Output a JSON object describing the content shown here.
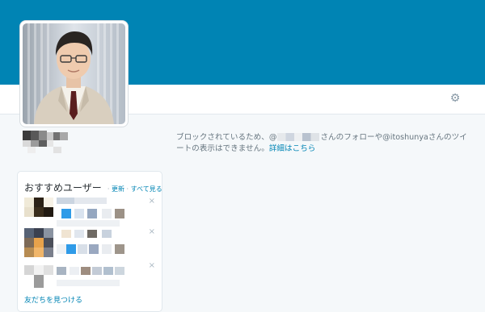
{
  "profile": {
    "settings_icon": "gear-icon",
    "blocked_message": {
      "prefix": "ブロックされているため、@",
      "middle": "さんのフォローや@itoshunya",
      "suffix": "さんのツイートの表示はできません。",
      "link_label": "詳細はこちら"
    }
  },
  "recommendations": {
    "title": "おすすめユーザー",
    "refresh_label": "更新",
    "view_all_label": "すべて見る",
    "separator": "·",
    "close_glyph": "×",
    "find_friends_label": "友だちを見つける"
  },
  "colors": {
    "banner": "#0084b4",
    "link": "#0084b4",
    "background": "#f5f8fa"
  }
}
